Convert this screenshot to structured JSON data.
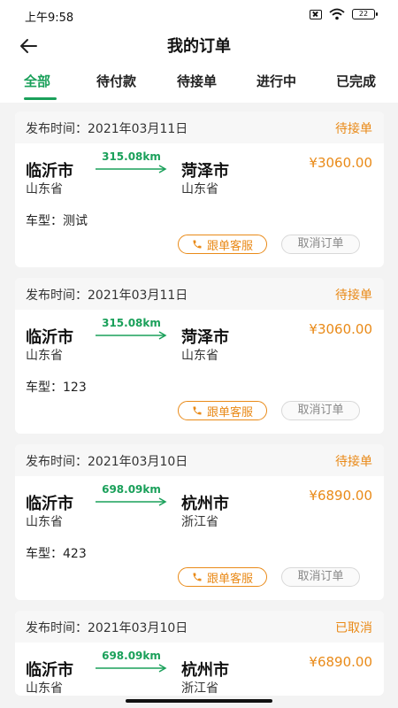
{
  "status_bar": {
    "time": "上午9:58",
    "battery": "22"
  },
  "header": {
    "title": "我的订单"
  },
  "tabs": [
    {
      "label": "全部"
    },
    {
      "label": "待付款"
    },
    {
      "label": "待接单"
    },
    {
      "label": "进行中"
    },
    {
      "label": "已完成"
    }
  ],
  "labels": {
    "publish_prefix": "发布时间：",
    "vehicle_prefix": "车型：",
    "service_button": "跟单客服",
    "cancel_button": "取消订单"
  },
  "orders": [
    {
      "publish_time": "2021年03月11日",
      "status": "待接单",
      "from_city": "临沂市",
      "from_province": "山东省",
      "distance": "315.08km",
      "to_city": "菏泽市",
      "to_province": "山东省",
      "price": "¥3060.00",
      "vehicle": "测试"
    },
    {
      "publish_time": "2021年03月11日",
      "status": "待接单",
      "from_city": "临沂市",
      "from_province": "山东省",
      "distance": "315.08km",
      "to_city": "菏泽市",
      "to_province": "山东省",
      "price": "¥3060.00",
      "vehicle": "123"
    },
    {
      "publish_time": "2021年03月10日",
      "status": "待接单",
      "from_city": "临沂市",
      "from_province": "山东省",
      "distance": "698.09km",
      "to_city": "杭州市",
      "to_province": "浙江省",
      "price": "¥6890.00",
      "vehicle": "423"
    },
    {
      "publish_time": "2021年03月10日",
      "status": "已取消",
      "from_city": "临沂市",
      "from_province": "山东省",
      "distance": "698.09km",
      "to_city": "杭州市",
      "to_province": "浙江省",
      "price": "¥6890.00",
      "vehicle": ""
    }
  ],
  "colors": {
    "accent_green": "#1aa05a",
    "accent_orange": "#e98a18"
  }
}
